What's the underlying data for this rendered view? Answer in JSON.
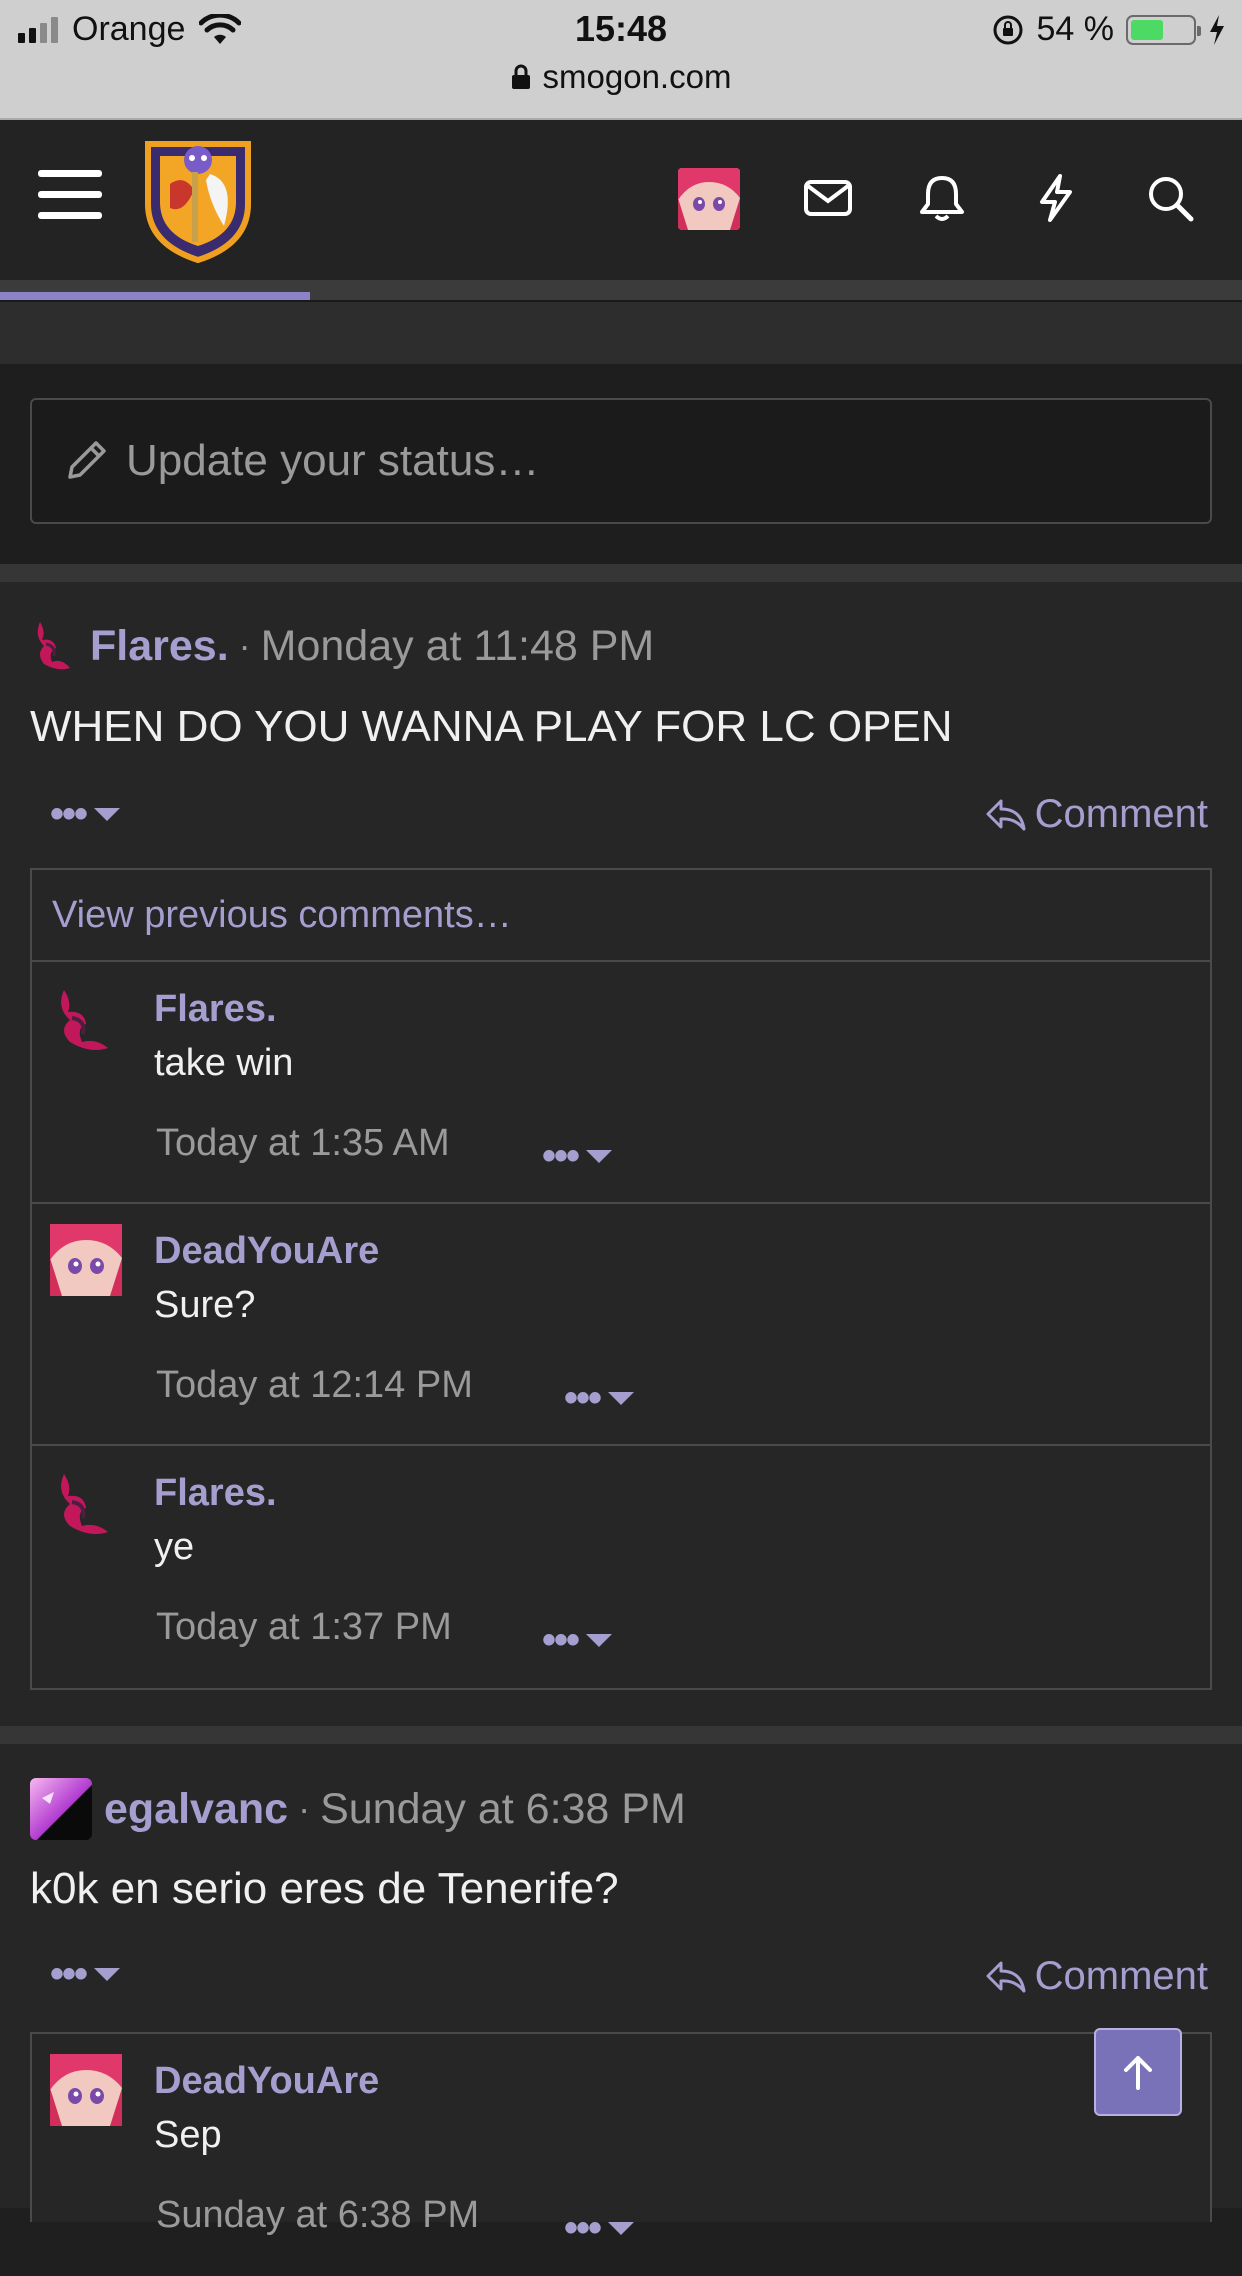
{
  "status_bar": {
    "carrier": "Orange",
    "time": "15:48",
    "battery_percent": "54 %",
    "battery_level": 0.54,
    "url": "smogon.com"
  },
  "status_box": {
    "placeholder": "Update your status…"
  },
  "posts": [
    {
      "author": "Flares.",
      "separator": "·",
      "time": "Monday at 11:48 PM",
      "text": "WHEN DO YOU WANNA PLAY FOR LC OPEN",
      "menu_dots": "•••",
      "comment_label": "Comment",
      "view_previous": "View previous comments…",
      "comments": [
        {
          "author": "Flares.",
          "text": "take win",
          "time": "Today at 1:35 AM",
          "menu_dots": "•••"
        },
        {
          "author": "DeadYouAre",
          "text": "Sure?",
          "time": "Today at 12:14 PM",
          "menu_dots": "•••"
        },
        {
          "author": "Flares.",
          "text": "ye",
          "time": "Today at 1:37 PM",
          "menu_dots": "•••"
        }
      ]
    },
    {
      "author": "egalvanc",
      "separator": "·",
      "time": "Sunday at 6:38 PM",
      "text": "k0k en serio eres de Tenerife?",
      "menu_dots": "•••",
      "comment_label": "Comment",
      "comments": [
        {
          "author": "DeadYouAre",
          "text": "Sep",
          "time": "Sunday at 6:38 PM",
          "menu_dots": "•••"
        }
      ]
    }
  ],
  "colors": {
    "accent": "#a59fd0",
    "background": "#1f1f1f",
    "panel": "#262626",
    "scroll_button": "#7a72b8"
  }
}
